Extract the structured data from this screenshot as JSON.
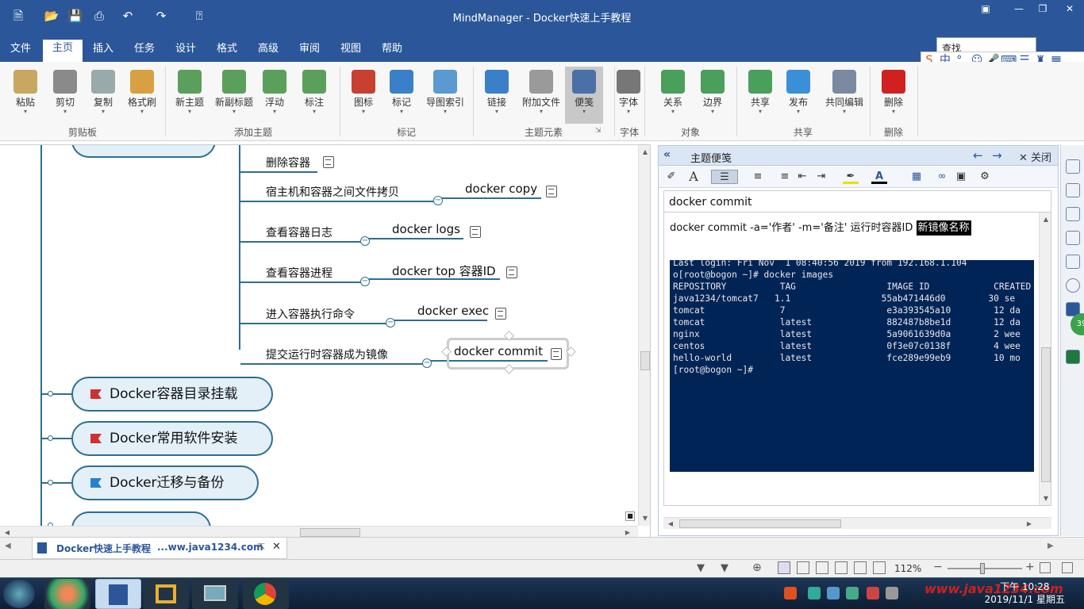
{
  "window": {
    "title": "MindManager - Docker快速上手教程"
  },
  "tabs": [
    "文件",
    "主页",
    "插入",
    "任务",
    "设计",
    "格式",
    "高级",
    "审阅",
    "视图",
    "帮助"
  ],
  "search": {
    "label": "查找"
  },
  "ribbon": {
    "buttons": [
      {
        "label": "粘贴",
        "icon": "paste-icon",
        "color": "#c8a860"
      },
      {
        "label": "剪切",
        "icon": "scissors-icon",
        "color": "#8a8a8a"
      },
      {
        "label": "复制",
        "icon": "copy-icon",
        "color": "#9aa"
      },
      {
        "label": "格式刷",
        "icon": "format-brush-icon",
        "color": "#d8a040"
      },
      {
        "label": "新主题",
        "icon": "new-topic-icon",
        "color": "#5aa05a"
      },
      {
        "label": "新副标题",
        "icon": "new-subtopic-icon",
        "color": "#5aa05a"
      },
      {
        "label": "浮动",
        "icon": "floating-topic-icon",
        "color": "#5aa05a"
      },
      {
        "label": "标注",
        "icon": "callout-icon",
        "color": "#5aa05a"
      },
      {
        "label": "图标",
        "icon": "icon-marker-icon",
        "color": "#c84030"
      },
      {
        "label": "标记",
        "icon": "tag-icon",
        "color": "#3a80c8"
      },
      {
        "label": "导图索引",
        "icon": "map-index-icon",
        "color": "#5a9ad0"
      },
      {
        "label": "链接",
        "icon": "link-icon",
        "color": "#3a80c8"
      },
      {
        "label": "附加文件",
        "icon": "attach-icon",
        "color": "#9a9a9a"
      },
      {
        "label": "便笺",
        "icon": "notes-icon",
        "color": "#4a70a8"
      },
      {
        "label": "字体",
        "icon": "font-icon",
        "color": "#777"
      },
      {
        "label": "关系",
        "icon": "relationship-icon",
        "color": "#4aa05a"
      },
      {
        "label": "边界",
        "icon": "boundary-icon",
        "color": "#4aa05a"
      },
      {
        "label": "共享",
        "icon": "share-icon",
        "color": "#4aa05a"
      },
      {
        "label": "发布",
        "icon": "publish-icon",
        "color": "#3a90d8"
      },
      {
        "label": "共同编辑",
        "icon": "coedit-icon",
        "color": "#7a8aa0"
      },
      {
        "label": "删除",
        "icon": "delete-icon",
        "color": "#d02020"
      }
    ],
    "groups": [
      "剪贴板",
      "添加主题",
      "标记",
      "主题元素",
      "字体",
      "对象",
      "共享",
      "删除"
    ]
  },
  "map": {
    "top_partial": "删除容器",
    "subtopics": [
      {
        "label": "删除容器",
        "cmd": ""
      },
      {
        "label": "宿主机和容器之间文件拷贝",
        "cmd": "docker copy"
      },
      {
        "label": "查看容器日志",
        "cmd": "docker logs"
      },
      {
        "label": "查看容器进程",
        "cmd": "docker top 容器ID"
      },
      {
        "label": "进入容器执行命令",
        "cmd": "docker exec"
      },
      {
        "label": "提交运行时容器成为镜像",
        "cmd": "docker commit"
      }
    ],
    "main_topics": [
      {
        "label": "Docker容器目录挂载",
        "flag_color": "#d03030"
      },
      {
        "label": "Docker常用软件安装",
        "flag_color": "#d03030"
      },
      {
        "label": "Docker迁移与备份",
        "flag_color": "#2a80d0"
      }
    ]
  },
  "notes": {
    "header": "主题便笺",
    "close": "关闭",
    "title": "docker commit",
    "cmd_prefix": "docker commit -a='作者' -m='备注' 运行时容器ID ",
    "cmd_highlight": "新镜像名称",
    "terminal": [
      "Last login: Fri Nov  1 08:40:56 2019 from 192.168.1.104",
      "o[root@bogon ~]# docker images",
      "REPOSITORY          TAG                 IMAGE ID            CREATED",
      "java1234/tomcat7   1.1                 55ab471446d0        30 se",
      "tomcat              7                   e3a393545a10        12 da",
      "tomcat              latest              882487b8be1d        12 da",
      "nginx               latest              5a9061639d0a        2 wee",
      "centos              latest              0f3e07c0138f        4 wee",
      "hello-world         latest              fce289e99eb9        10 mo",
      "[root@bogon ~]#"
    ]
  },
  "doctab": {
    "label": "Docker快速上手教程",
    "site": "...ww.java1234.com"
  },
  "status": {
    "zoom": "112%"
  },
  "taskbar": {
    "time": "下午 10:28",
    "date": "2019/11/1 星期五",
    "watermark": "www.java1234.com"
  }
}
